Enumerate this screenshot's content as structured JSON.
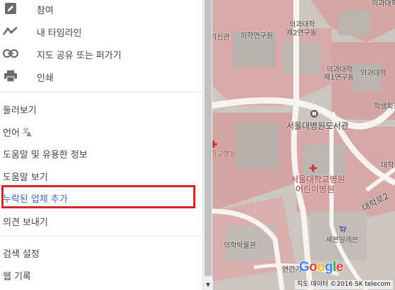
{
  "menu": {
    "icon_items": [
      {
        "label": "참여",
        "icon": "pencil-icon"
      },
      {
        "label": "내 타임라인",
        "icon": "timeline-icon"
      },
      {
        "label": "지도 공유 또는 퍼가기",
        "icon": "link-icon"
      },
      {
        "label": "인쇄",
        "icon": "print-icon"
      }
    ],
    "tour": "둘러보기",
    "language": "언어",
    "language_icon": "translate-icon",
    "help_info": "도움말 및 유용한 정보",
    "help": "도움말 보기",
    "add_missing_place": "누락된 업체 추가",
    "send_feedback": "의견 보내기",
    "search_settings": "검색 설정",
    "web_history": "웹 기록"
  },
  "map": {
    "labels": {
      "uisin": "의신관",
      "med_research": "의학연구원",
      "med_college_2_a": "의과대학",
      "med_college_2_b": "제2연구동",
      "med_college_1_a": "의과대학",
      "med_college_1_b": "제1연구동",
      "med_college_3": "의과대학",
      "med_college_top": "의과대학",
      "student_hall": "학생회관",
      "snuh_library": "서울대병원도서관",
      "hospital": "학교병원",
      "snuh_children_a": "서울대학교병원",
      "snuh_children_b": "어린이병원",
      "university_partial": "대학",
      "daehakro": "대학로2",
      "med_museum": "의학박물관",
      "seven_eleven": "세븐일레븐",
      "yeongeon": "연건기"
    },
    "google_logo": [
      "G",
      "o",
      "o",
      "g",
      "l",
      "e"
    ],
    "google_colors": [
      "#4285f4",
      "#ea4335",
      "#fbbc05",
      "#4285f4",
      "#34a853",
      "#ea4335"
    ],
    "attribution": "지도 데이터 ©2016 SK telecom"
  },
  "colors": {
    "highlight": "#d1262c",
    "link": "#3b66c4",
    "hospital_cross": "#c7332f"
  }
}
